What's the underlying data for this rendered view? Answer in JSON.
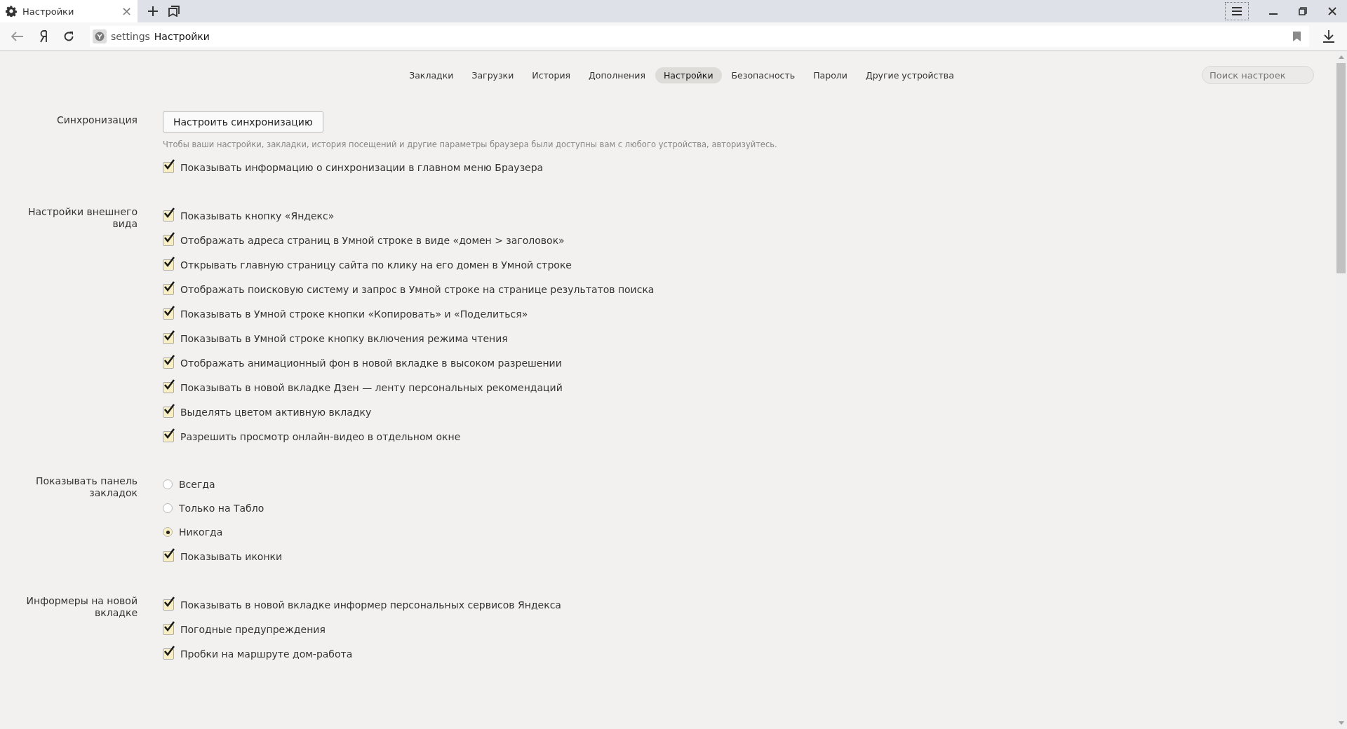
{
  "browser_tab": {
    "title": "Настройки",
    "close": "×"
  },
  "address_bar": {
    "scheme": "settings",
    "title": "Настройки"
  },
  "nav_tabs": [
    {
      "label": "Закладки",
      "selected": false
    },
    {
      "label": "Загрузки",
      "selected": false
    },
    {
      "label": "История",
      "selected": false
    },
    {
      "label": "Дополнения",
      "selected": false
    },
    {
      "label": "Настройки",
      "selected": true
    },
    {
      "label": "Безопасность",
      "selected": false
    },
    {
      "label": "Пароли",
      "selected": false
    },
    {
      "label": "Другие устройства",
      "selected": false
    }
  ],
  "search": {
    "placeholder": "Поиск настроек"
  },
  "sections": [
    {
      "label": "Синхронизация",
      "items": [
        {
          "kind": "button",
          "text": "Настроить синхронизацию"
        },
        {
          "kind": "hint",
          "text": "Чтобы ваши настройки, закладки, история посещений и другие параметры браузера были доступны вам с любого устройства, авторизуйтесь."
        },
        {
          "kind": "checkbox",
          "text": "Показывать информацию о синхронизации в главном меню Браузера",
          "checked": true
        }
      ]
    },
    {
      "label": "Настройки внешнего вида",
      "items": [
        {
          "kind": "checkbox",
          "text": "Показывать кнопку «Яндекс»",
          "checked": true
        },
        {
          "kind": "checkbox",
          "text": "Отображать адреса страниц в Умной строке в виде «домен > заголовок»",
          "checked": true
        },
        {
          "kind": "checkbox",
          "text": "Открывать главную страницу сайта по клику на его домен в Умной строке",
          "checked": true
        },
        {
          "kind": "checkbox",
          "text": "Отображать поисковую систему и запрос в Умной строке на странице результатов поиска",
          "checked": true
        },
        {
          "kind": "checkbox",
          "text": "Показывать в Умной строке кнопки «Копировать» и «Поделиться»",
          "checked": true
        },
        {
          "kind": "checkbox",
          "text": "Показывать в Умной строке кнопку включения режима чтения",
          "checked": true
        },
        {
          "kind": "checkbox",
          "text": "Отображать анимационный фон в новой вкладке в высоком разрешении",
          "checked": true
        },
        {
          "kind": "checkbox",
          "text": "Показывать в новой вкладке Дзен — ленту персональных рекомендаций",
          "checked": true
        },
        {
          "kind": "checkbox",
          "text": "Выделять цветом активную вкладку",
          "checked": true
        },
        {
          "kind": "checkbox",
          "text": "Разрешить просмотр онлайн-видео в отдельном окне",
          "checked": true
        }
      ]
    },
    {
      "label": "Показывать панель закладок",
      "items": [
        {
          "kind": "radio",
          "text": "Всегда",
          "selected": false
        },
        {
          "kind": "radio",
          "text": "Только на Табло",
          "selected": false
        },
        {
          "kind": "radio",
          "text": "Никогда",
          "selected": true
        },
        {
          "kind": "checkbox",
          "text": "Показывать иконки",
          "checked": true
        }
      ]
    },
    {
      "label": "Информеры на новой вкладке",
      "items": [
        {
          "kind": "checkbox",
          "text": "Показывать в новой вкладке информер персональных сервисов Яндекса",
          "checked": true
        },
        {
          "kind": "checkbox",
          "text": "Погодные предупреждения",
          "checked": true
        },
        {
          "kind": "checkbox",
          "text": "Пробки на маршруте дом-работа",
          "checked": true
        }
      ]
    }
  ]
}
